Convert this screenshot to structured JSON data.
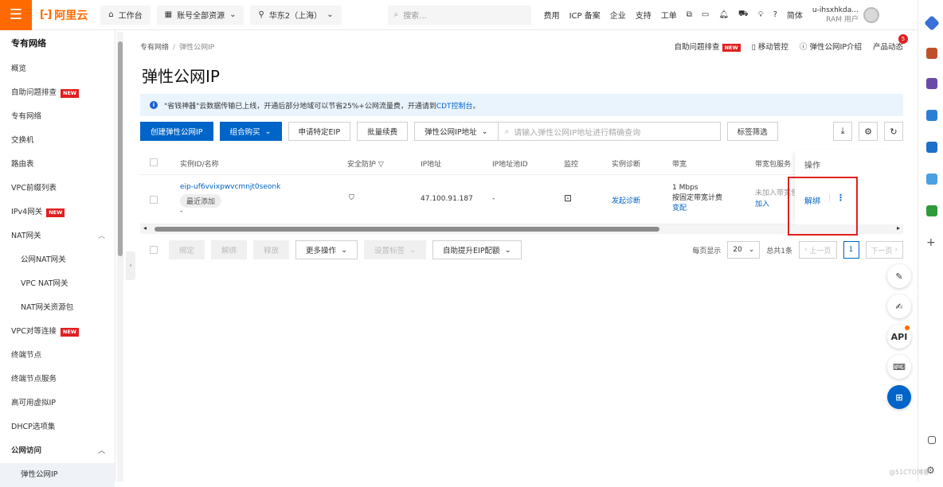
{
  "topbar": {
    "brand": "阿里云",
    "workbench": "工作台",
    "resources": "账号全部资源",
    "region": "华东2（上海）",
    "search_placeholder": "搜索...",
    "links": [
      "费用",
      "ICP 备案",
      "企业",
      "支持",
      "工单"
    ],
    "lang": "简体",
    "user_name": "u-ihsxhkda...",
    "user_role": "RAM 用户"
  },
  "sidebar": {
    "title": "专有网络",
    "items": [
      {
        "label": "概览",
        "type": "item"
      },
      {
        "label": "自助问题排查",
        "type": "item",
        "badge": "NEW"
      },
      {
        "label": "专有网络",
        "type": "item"
      },
      {
        "label": "交换机",
        "type": "item"
      },
      {
        "label": "路由表",
        "type": "item"
      },
      {
        "label": "VPC前缀列表",
        "type": "item"
      },
      {
        "label": "IPv4网关",
        "type": "item",
        "badge": "NEW"
      },
      {
        "label": "NAT网关",
        "type": "item",
        "expanded": true
      },
      {
        "label": "公网NAT网关",
        "type": "sub"
      },
      {
        "label": "VPC NAT网关",
        "type": "sub"
      },
      {
        "label": "NAT网关资源包",
        "type": "sub"
      },
      {
        "label": "VPC对等连接",
        "type": "item",
        "badge": "NEW"
      },
      {
        "label": "终端节点",
        "type": "item"
      },
      {
        "label": "终端节点服务",
        "type": "item"
      },
      {
        "label": "高可用虚拟IP",
        "type": "item"
      },
      {
        "label": "DHCP选项集",
        "type": "item"
      },
      {
        "label": "公网访问",
        "type": "group",
        "expanded": true
      },
      {
        "label": "弹性公网IP",
        "type": "sub",
        "active": true
      }
    ]
  },
  "breadcrumb": {
    "root": "专有网络",
    "current": "弹性公网IP"
  },
  "header_actions": {
    "self_check": "自助问题排查",
    "self_check_badge": "NEW",
    "mobile": "移动管控",
    "intro": "弹性公网IP介绍",
    "news": "产品动态",
    "news_count": "5"
  },
  "page_title": "弹性公网IP",
  "notice": {
    "text": "\"省钱神器\"云数据传输已上线，开通后部分地域可以节省25%+公网流量费，开通请到",
    "link": "CDT控制台",
    "suffix": "。"
  },
  "toolbar": {
    "create": "创建弹性公网IP",
    "combo": "组合购买",
    "apply": "申请特定EIP",
    "renew": "批量续费",
    "filter_select": "弹性公网IP地址",
    "search_placeholder": "请输入弹性公网IP地址进行精确查询",
    "tag_filter": "标签筛选"
  },
  "table": {
    "headers": [
      "实例ID/名称",
      "安全防护",
      "IP地址",
      "IP地址池ID",
      "监控",
      "实例诊断",
      "带宽",
      "带宽包服务",
      "操作"
    ],
    "rows": [
      {
        "id": "eip-uf6vvixpwvcmnjt0seonk",
        "tag": "最近添加",
        "name": "-",
        "ip": "47.100.91.187",
        "pool": "-",
        "diag": "发起诊断",
        "bw": "1 Mbps",
        "billing": "按固定带宽计费",
        "change": "变配",
        "pkg": "未加入带宽包",
        "pkg_join": "加入",
        "op": "解绑"
      }
    ]
  },
  "bottom": {
    "bind": "绑定",
    "unbind": "解绑",
    "release": "释放",
    "more": "更多操作",
    "set_tag": "设置标签",
    "auto_upgrade": "自助提升EIP配额",
    "per_page_label": "每页显示",
    "per_page": "20",
    "total": "总共1条",
    "prev": "上一页",
    "page": "1",
    "next": "下一页"
  },
  "watermark": "@51CTO博客"
}
